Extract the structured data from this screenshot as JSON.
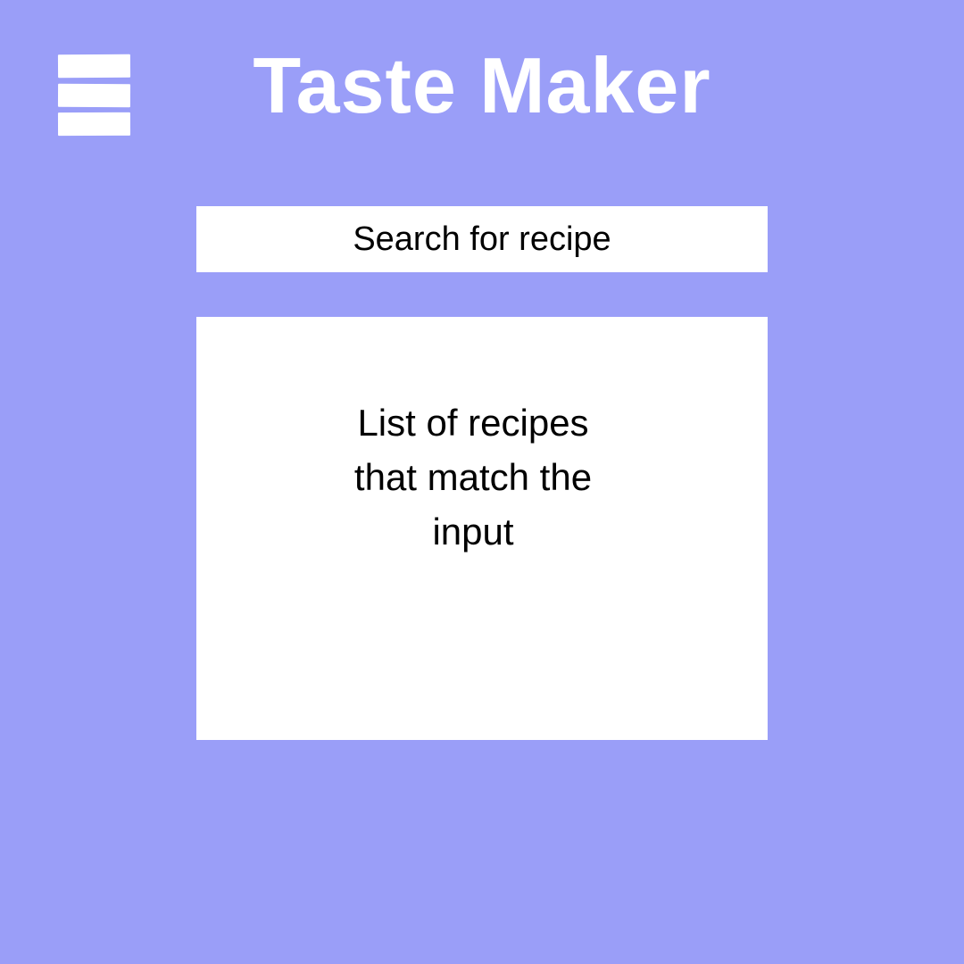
{
  "header": {
    "title": "Taste Maker",
    "menu_icon": "hamburger-menu-icon"
  },
  "search": {
    "label": "Search for recipe"
  },
  "results": {
    "text": "List of recipes\nthat match the\ninput"
  },
  "colors": {
    "background": "#9a9ef8",
    "panel": "#ffffff",
    "title_text": "#ffffff",
    "body_text": "#000000"
  }
}
